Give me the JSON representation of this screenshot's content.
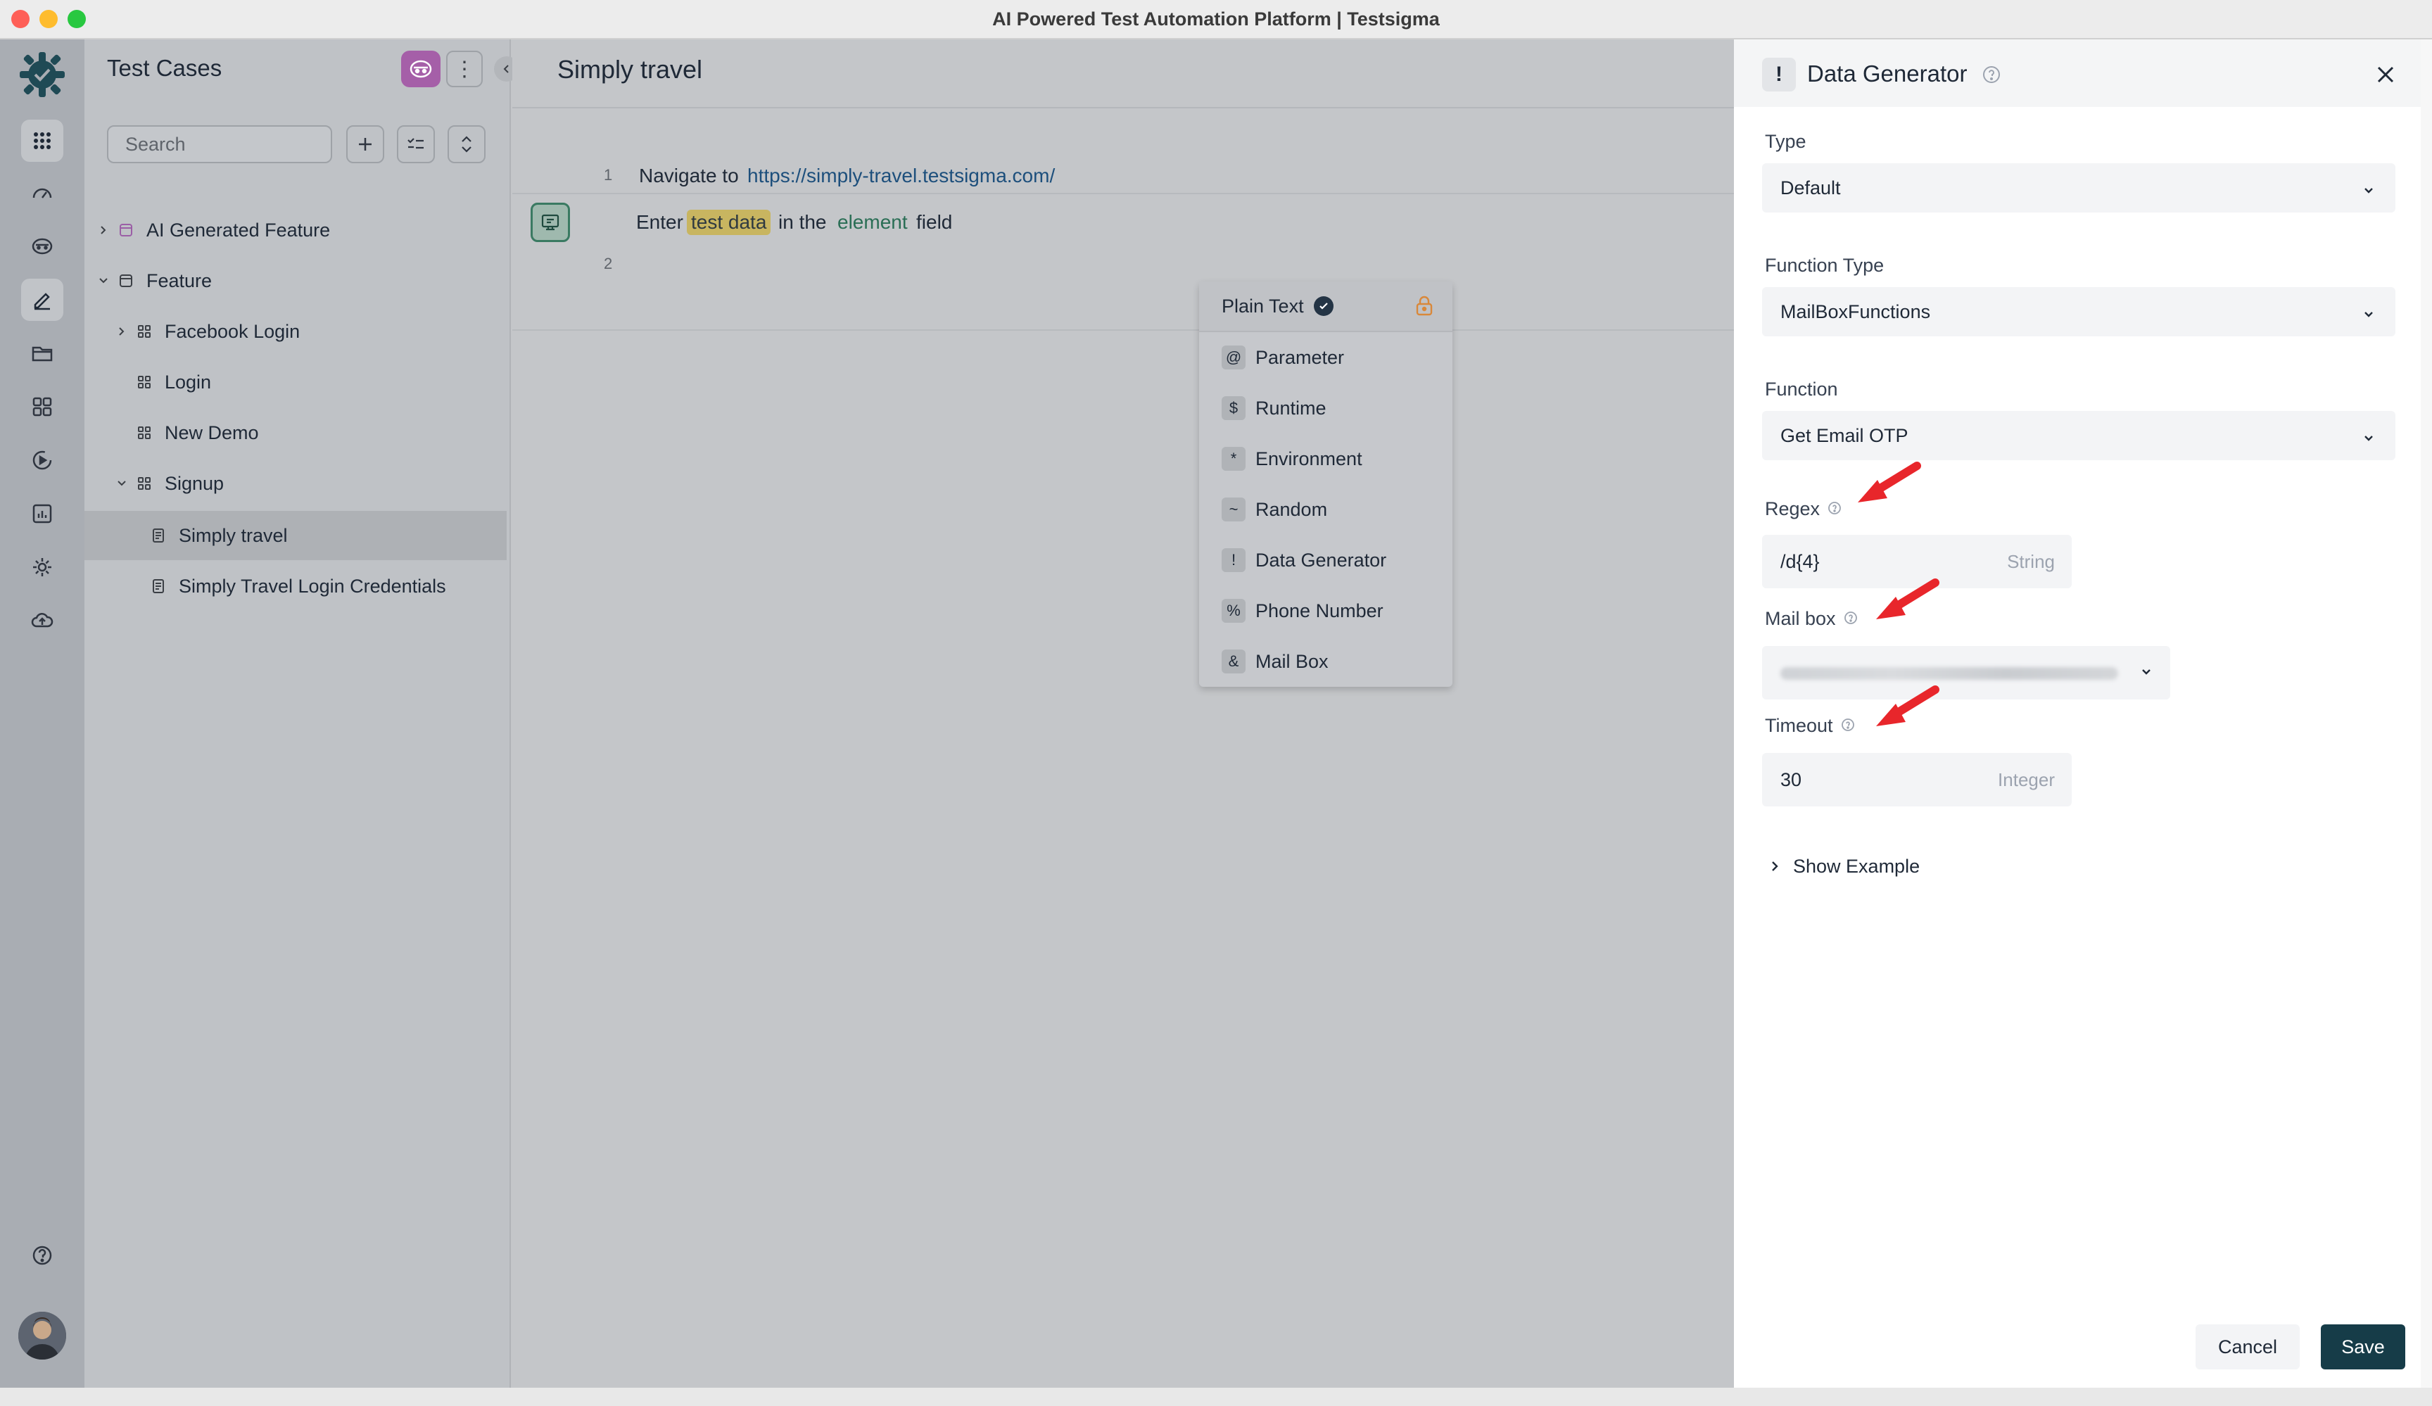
{
  "window": {
    "title": "AI Powered Test Automation Platform | Testsigma"
  },
  "left_panel": {
    "title": "Test Cases",
    "search_placeholder": "Search",
    "tree": [
      {
        "label": "AI Generated Feature"
      },
      {
        "label": "Feature"
      },
      {
        "label": "Facebook Login"
      },
      {
        "label": "Login"
      },
      {
        "label": "New Demo"
      },
      {
        "label": "Signup"
      },
      {
        "label": "Simply travel"
      },
      {
        "label": "Simply Travel Login Credentials"
      }
    ]
  },
  "main": {
    "title": "Simply travel",
    "steps": [
      {
        "number": "1",
        "action": "Navigate to",
        "url": "https://simply-travel.testsigma.com/"
      },
      {
        "number": "2",
        "action": "Enter",
        "test_data": "test data",
        "connector": "in the",
        "element": "element",
        "suffix": "field"
      }
    ],
    "dropdown": [
      {
        "label": "Plain Text",
        "symbol": ""
      },
      {
        "label": "Parameter",
        "symbol": "@"
      },
      {
        "label": "Runtime",
        "symbol": "$"
      },
      {
        "label": "Environment",
        "symbol": "*"
      },
      {
        "label": "Random",
        "symbol": "~"
      },
      {
        "label": "Data Generator",
        "symbol": "!"
      },
      {
        "label": "Phone Number",
        "symbol": "%"
      },
      {
        "label": "Mail Box",
        "symbol": "&"
      }
    ]
  },
  "drawer": {
    "icon_symbol": "!",
    "title": "Data Generator",
    "type_label": "Type",
    "type_value": "Default",
    "function_type_label": "Function Type",
    "function_type_value": "MailBoxFunctions",
    "function_label": "Function",
    "function_value": "Get Email OTP",
    "regex_label": "Regex",
    "regex_value": "/d{4}",
    "regex_type": "String",
    "mailbox_label": "Mail box",
    "timeout_label": "Timeout",
    "timeout_value": "30",
    "timeout_type": "Integer",
    "show_example": "Show Example",
    "cancel": "Cancel",
    "save": "Save"
  },
  "colors": {
    "accent_dark": "#163c48",
    "annotation_arrow": "#e8262b",
    "selected_chip": "#c8b560"
  }
}
